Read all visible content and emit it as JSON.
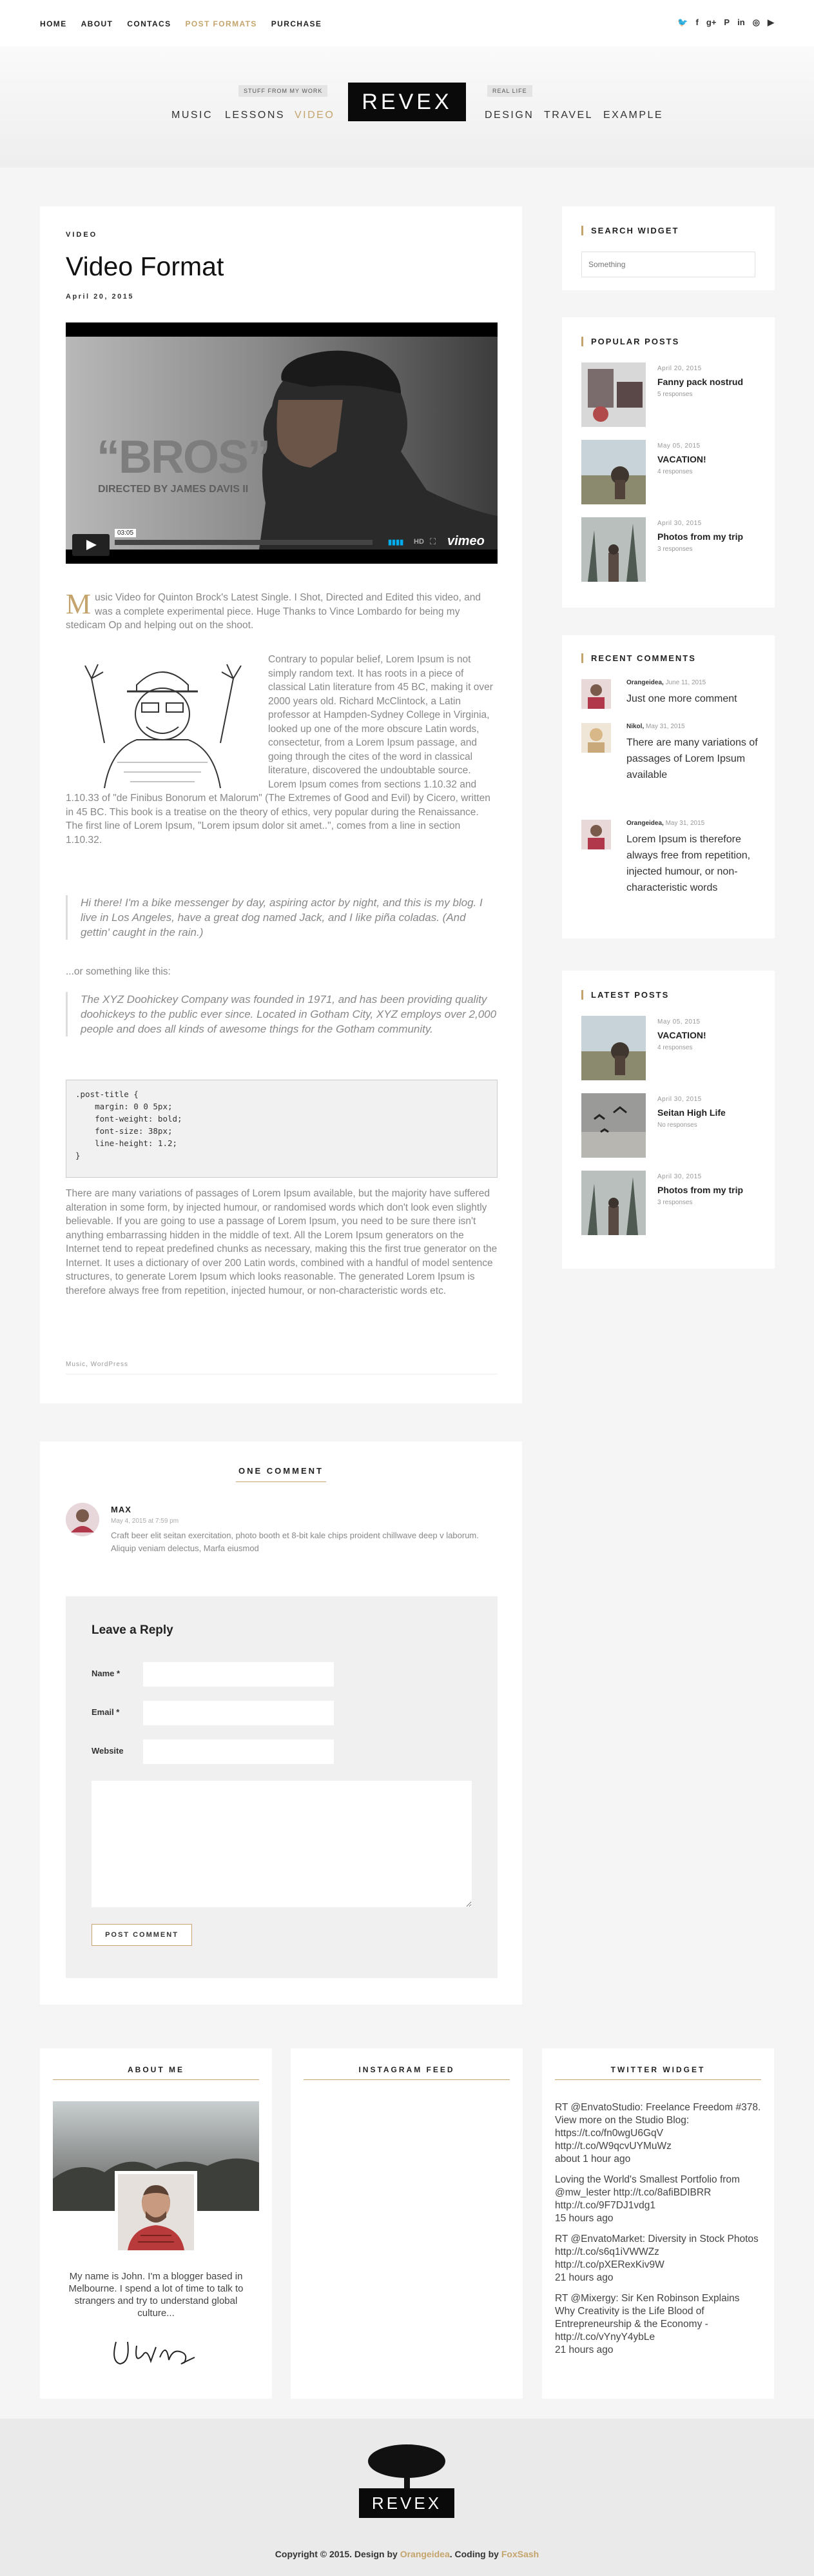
{
  "topnav": [
    "HOME",
    "ABOUT",
    "CONTACS",
    "POST FORMATS",
    "PURCHASE"
  ],
  "social": [
    "🐦",
    "f",
    "g+",
    "P",
    "in",
    "◎",
    "▶"
  ],
  "header": {
    "nav_left": [
      "MUSIC",
      "LESSONS",
      "VIDEO"
    ],
    "nav_right": [
      "DESIGN",
      "TRAVEL",
      "EXAMPLE"
    ],
    "badge_left": "STUFF FROM MY WORK",
    "badge_right": "REAL LIFE",
    "logo": "REVEX"
  },
  "post": {
    "kicker": "VIDEO",
    "title": "Video Format",
    "date": "April 20, 2015",
    "video": {
      "title_overlay": "“BROS”",
      "subtitle_overlay": "DIRECTED BY JAMES DAVIS II",
      "time": "03:05",
      "brand": "vimeo"
    },
    "dropcap": "M",
    "intro": "usic Video for Quinton Brock's Latest Single. I Shot, Directed and Edited this video, and was a complete experimental piece. Huge Thanks to Vince Lombardo for being my stedicam Op and helping out on the shoot.",
    "para1": "Contrary to popular belief, Lorem Ipsum is not simply random text. It has roots in a piece of classical Latin literature from 45 BC, making it over 2000 years old. Richard McClintock, a Latin professor at Hampden-Sydney College in Virginia, looked up one of the more obscure Latin words, consectetur, from a Lorem Ipsum passage, and going through the cites of the word in classical literature, discovered the undoubtable source. Lorem Ipsum comes from sections 1.10.32 and 1.10.33 of \"de Finibus Bonorum et Malorum\" (The Extremes of Good and Evil) by Cicero, written in 45 BC. This book is a treatise on the theory of ethics, very popular during the Renaissance. The first line of Lorem Ipsum, \"Lorem ipsum dolor sit amet..\", comes from a line in section 1.10.32.",
    "quote1": "Hi there! I'm a bike messenger by day, aspiring actor by night, and this is my blog. I live in Los Angeles, have a great dog named Jack, and I like piña coladas. (And gettin' caught in the rain.)",
    "or_text": "...or something like this:",
    "quote2": "The XYZ Doohickey Company was founded in 1971, and has been providing quality doohickeys to the public ever since. Located in Gotham City, XYZ employs over 2,000 people and does all kinds of awesome things for the Gotham community.",
    "code": ".post-title {\n    margin: 0 0 5px;\n    font-weight: bold;\n    font-size: 38px;\n    line-height: 1.2;\n}",
    "para2": "There are many variations of passages of Lorem Ipsum available, but the majority have suffered alteration in some form, by injected humour, or randomised words which don't look even slightly believable. If you are going to use a passage of Lorem Ipsum, you need to be sure there isn't anything embarrassing hidden in the middle of text. All the Lorem Ipsum generators on the Internet tend to repeat predefined chunks as necessary, making this the first true generator on the Internet. It uses a dictionary of over 200 Latin words, combined with a handful of model sentence structures, to generate Lorem Ipsum which looks reasonable. The generated Lorem Ipsum is therefore always free from repetition, injected humour, or non-characteristic words etc.",
    "tags": "Music, WordPress"
  },
  "sidebar": {
    "search_title": "SEARCH WIDGET",
    "search_placeholder": "Something",
    "popular_title": "POPULAR POSTS",
    "popular": [
      {
        "date": "April 20, 2015",
        "title": "Fanny pack nostrud",
        "resp": "5 responses"
      },
      {
        "date": "May 05, 2015",
        "title": "VACATION!",
        "resp": "4 responses"
      },
      {
        "date": "April 30, 2015",
        "title": "Photos from my trip",
        "resp": "3 responses"
      }
    ],
    "comments_title": "RECENT COMMENTS",
    "comments": [
      {
        "author": "Orangeidea,",
        "date": "June 11, 2015",
        "text": "Just one more comment"
      },
      {
        "author": "Nikol,",
        "date": "May 31, 2015",
        "text": "There are many variations of passages of Lorem Ipsum available"
      },
      {
        "author": "Orangeidea,",
        "date": "May 31, 2015",
        "text": "Lorem Ipsum is therefore always free from repetition, injected humour, or non-characteristic words"
      }
    ],
    "latest_title": "LATEST POSTS",
    "latest": [
      {
        "date": "May 05, 2015",
        "title": "VACATION!",
        "resp": "4 responses"
      },
      {
        "date": "April 30, 2015",
        "title": "Seitan High Life",
        "resp": "No responses"
      },
      {
        "date": "April 30, 2015",
        "title": "Photos from my trip",
        "resp": "3 responses"
      }
    ]
  },
  "comments": {
    "title": "ONE COMMENT",
    "author": "MAX",
    "date": "May 4, 2015 at 7:59 pm",
    "text": "Craft beer elit seitan exercitation, photo booth et 8-bit kale chips proident chillwave deep v laborum. Aliquip veniam delectus, Marfa eiusmod",
    "reply_title": "Leave a Reply",
    "name_label": "Name *",
    "email_label": "Email *",
    "website_label": "Website",
    "submit": "POST COMMENT"
  },
  "footer_widgets": {
    "about_title": "ABOUT ME",
    "about_text": "My name is John. I'm a blogger based in Melbourne. I spend a lot of time to talk to strangers and try to understand global culture...",
    "signature": "Jw3ke",
    "instagram_title": "INSTAGRAM FEED",
    "twitter_title": "TWITTER WIDGET",
    "tweets": [
      {
        "text": "RT @EnvatoStudio: Freelance Freedom #378. View more on the Studio Blog: https://t.co/fn0wgU6GqV http://t.co/W9qcvUYMuWz",
        "time": "about 1 hour ago"
      },
      {
        "text": "Loving the World's Smallest Portfolio from @mw_lester http://t.co/8afiBDIBRR http://t.co/9F7DJ1vdg1",
        "time": "15 hours ago"
      },
      {
        "text": "RT @EnvatoMarket: Diversity in Stock Photos http://t.co/s6q1iVWWZz http://t.co/pXERexKiv9W",
        "time": "21 hours ago"
      },
      {
        "text": "RT @Mixergy: Sir Ken Robinson Explains Why Creativity is the Life Blood of Entrepreneurship & the Economy - http://t.co/vYnyY4ybLe",
        "time": "21 hours ago"
      }
    ]
  },
  "footer": {
    "logo": "REVEX",
    "copy_prefix": "Copyright © 2015. Design by",
    "design_by": "Orangeidea",
    "coding_prefix": ". Coding by",
    "coding_by": "FoxSash"
  },
  "colors": {
    "accent": "#c4a46c",
    "bg": "#f5f5f5",
    "dark": "#0a0a0a"
  }
}
